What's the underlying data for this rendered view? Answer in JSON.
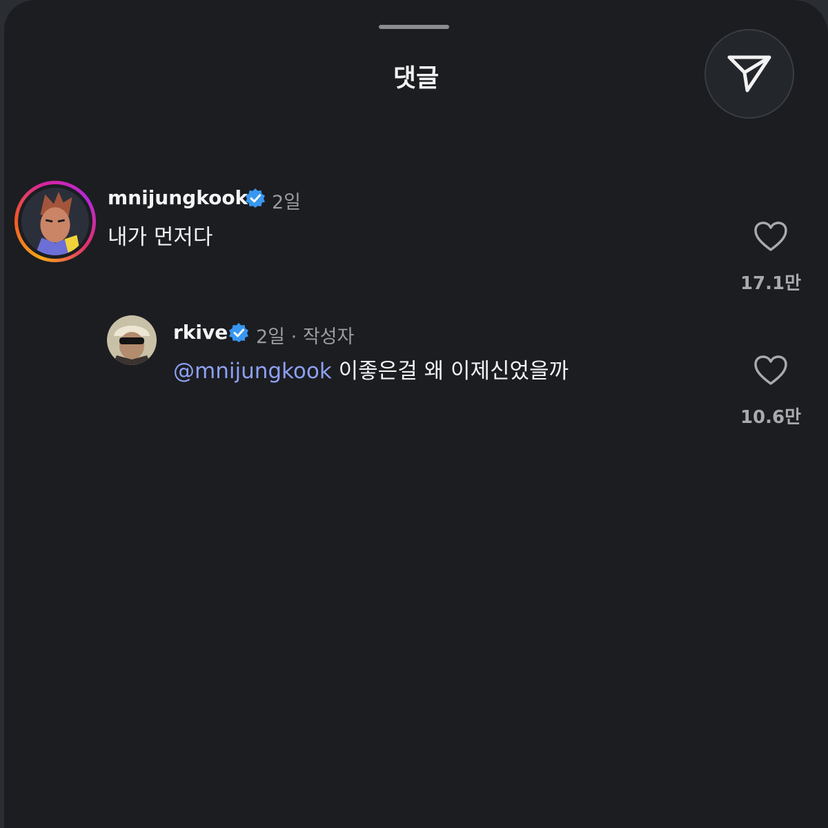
{
  "sheet": {
    "title": "댓글"
  },
  "comments": [
    {
      "username": "mnijungkook",
      "time": "2일",
      "text": "내가 먼저다",
      "like_count": "17.1만"
    },
    {
      "username": "rkive",
      "time": "2일",
      "separator": "·",
      "author_tag": "작성자",
      "mention": "@mnijungkook",
      "text": "이좋은걸 왜 이제신었을까",
      "like_count": "10.6만"
    }
  ],
  "colors": {
    "background": "#1b1d21",
    "mention": "#8ea0f4",
    "verified": "#3897f0",
    "muted": "#9a9ca0"
  }
}
